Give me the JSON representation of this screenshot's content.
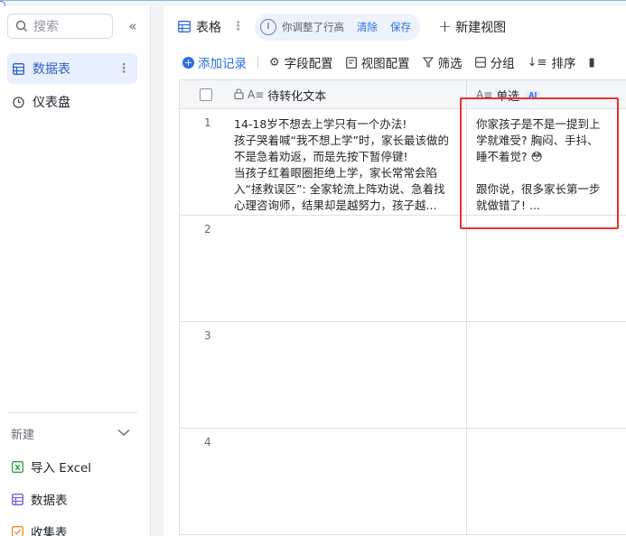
{
  "sidebar": {
    "search_placeholder": "搜索",
    "collapse_label": "«",
    "items": [
      {
        "label": "数据表",
        "active": true
      },
      {
        "label": "仪表盘",
        "active": false
      }
    ],
    "new_section": {
      "title": "新建",
      "items": [
        {
          "label": "导入 Excel",
          "icon": "excel-icon",
          "color": "#2ea043"
        },
        {
          "label": "数据表",
          "icon": "table-icon",
          "color": "#7b5cd6"
        },
        {
          "label": "收集表",
          "icon": "form-icon",
          "color": "#f08a24"
        }
      ]
    }
  },
  "header": {
    "tab_label": "表格",
    "adjust_text": "你调整了行高",
    "clear_label": "清除",
    "save_label": "保存",
    "new_view_label": "新建视图"
  },
  "toolbar": {
    "add_record": "添加记录",
    "field_config": "字段配置",
    "view_config": "视图配置",
    "filter": "筛选",
    "group": "分组",
    "sort": "排序"
  },
  "grid": {
    "col1_header": "待转化文本",
    "col2_header": "单选",
    "ai_badge": "AI",
    "rows": [
      {
        "num": "1",
        "col1_lines": [
          "14-18岁不想去上学只有一个办法!",
          "孩子哭着喊“我不想上学”时，家长最该做的",
          "不是急着劝返，而是先按下暂停键!",
          "当孩子红着眼圈拒绝上学，家长常常会陷",
          "入“拯救误区”: 全家轮流上阵劝说、急着找",
          "心理咨询师，结果却是越努力，孩子越..."
        ],
        "col2_lines": [
          "你家孩子是不是一提到上",
          "学就难受? 胸闷、手抖、",
          "睡不着觉? 😳",
          "",
          "跟你说，很多家长第一步",
          "就做错了! ..."
        ]
      },
      {
        "num": "2"
      },
      {
        "num": "3"
      },
      {
        "num": "4"
      }
    ]
  },
  "colors": {
    "accent": "#2b6fe6",
    "highlight": "#e8322f"
  }
}
